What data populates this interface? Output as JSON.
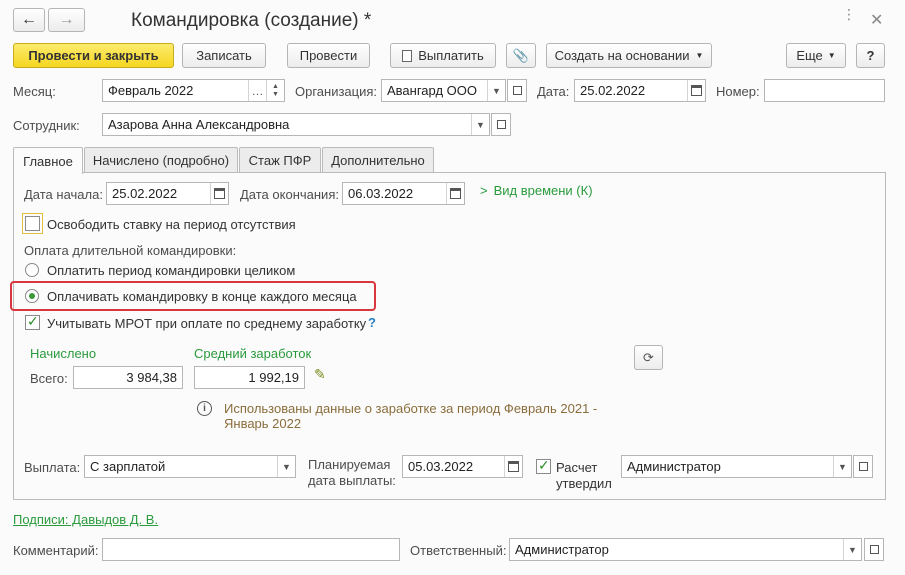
{
  "window": {
    "title": "Командировка (создание) *",
    "nav_back": "←",
    "nav_forward": "→"
  },
  "toolbar": {
    "post_close": "Провести и закрыть",
    "save": "Записать",
    "post": "Провести",
    "pay": "Выплатить",
    "create_based": "Создать на основании",
    "more": "Еще",
    "help": "?"
  },
  "header": {
    "month_label": "Месяц:",
    "month_value": "Февраль 2022",
    "org_label": "Организация:",
    "org_value": "Авангард ООО",
    "date_label": "Дата:",
    "date_value": "25.02.2022",
    "number_label": "Номер:",
    "number_value": "",
    "employee_label": "Сотрудник:",
    "employee_value": "Азарова Анна Александровна"
  },
  "tabs": [
    {
      "label": "Главное"
    },
    {
      "label": "Начислено (подробно)"
    },
    {
      "label": "Стаж ПФР"
    },
    {
      "label": "Дополнительно"
    }
  ],
  "main": {
    "start_label": "Дата начала:",
    "start_value": "25.02.2022",
    "end_label": "Дата окончания:",
    "end_value": "06.03.2022",
    "time_kind": "Вид времени (К)",
    "free_rate": "Освободить ставку на период отсутствия",
    "long_trip_label": "Оплата длительной командировки:",
    "option_whole": "Оплатить период командировки целиком",
    "option_monthly": "Оплачивать командировку в конце каждого месяца",
    "mrot": "Учитывать МРОТ при оплате по среднему заработку",
    "mrot_help": "?",
    "accrued_header": "Начислено",
    "avg_header": "Средний заработок",
    "total_label": "Всего:",
    "accrued_value": "3 984,38",
    "avg_value": "1 992,19",
    "info_text_1": "Использованы данные о заработке за период Февраль 2021 -",
    "info_text_2": "Январь 2022",
    "payout_label": "Выплата:",
    "payout_value": "С зарплатой",
    "planned_label_1": "Планируемая",
    "planned_label_2": "дата выплаты:",
    "planned_value": "05.03.2022",
    "calc_label_1": "Расчет",
    "calc_label_2": "утвердил",
    "approver_value": "Администратор"
  },
  "footer": {
    "signatures": "Подписи: Давыдов Д. В.",
    "comment_label": "Комментарий:",
    "comment_value": "",
    "responsible_label": "Ответственный:",
    "responsible_value": "Администратор"
  },
  "colors": {
    "primary_button": "#f5d620",
    "accent_green": "#2a9a3c",
    "highlight_red": "#d9363e",
    "info_text": "#8a6d3b"
  }
}
